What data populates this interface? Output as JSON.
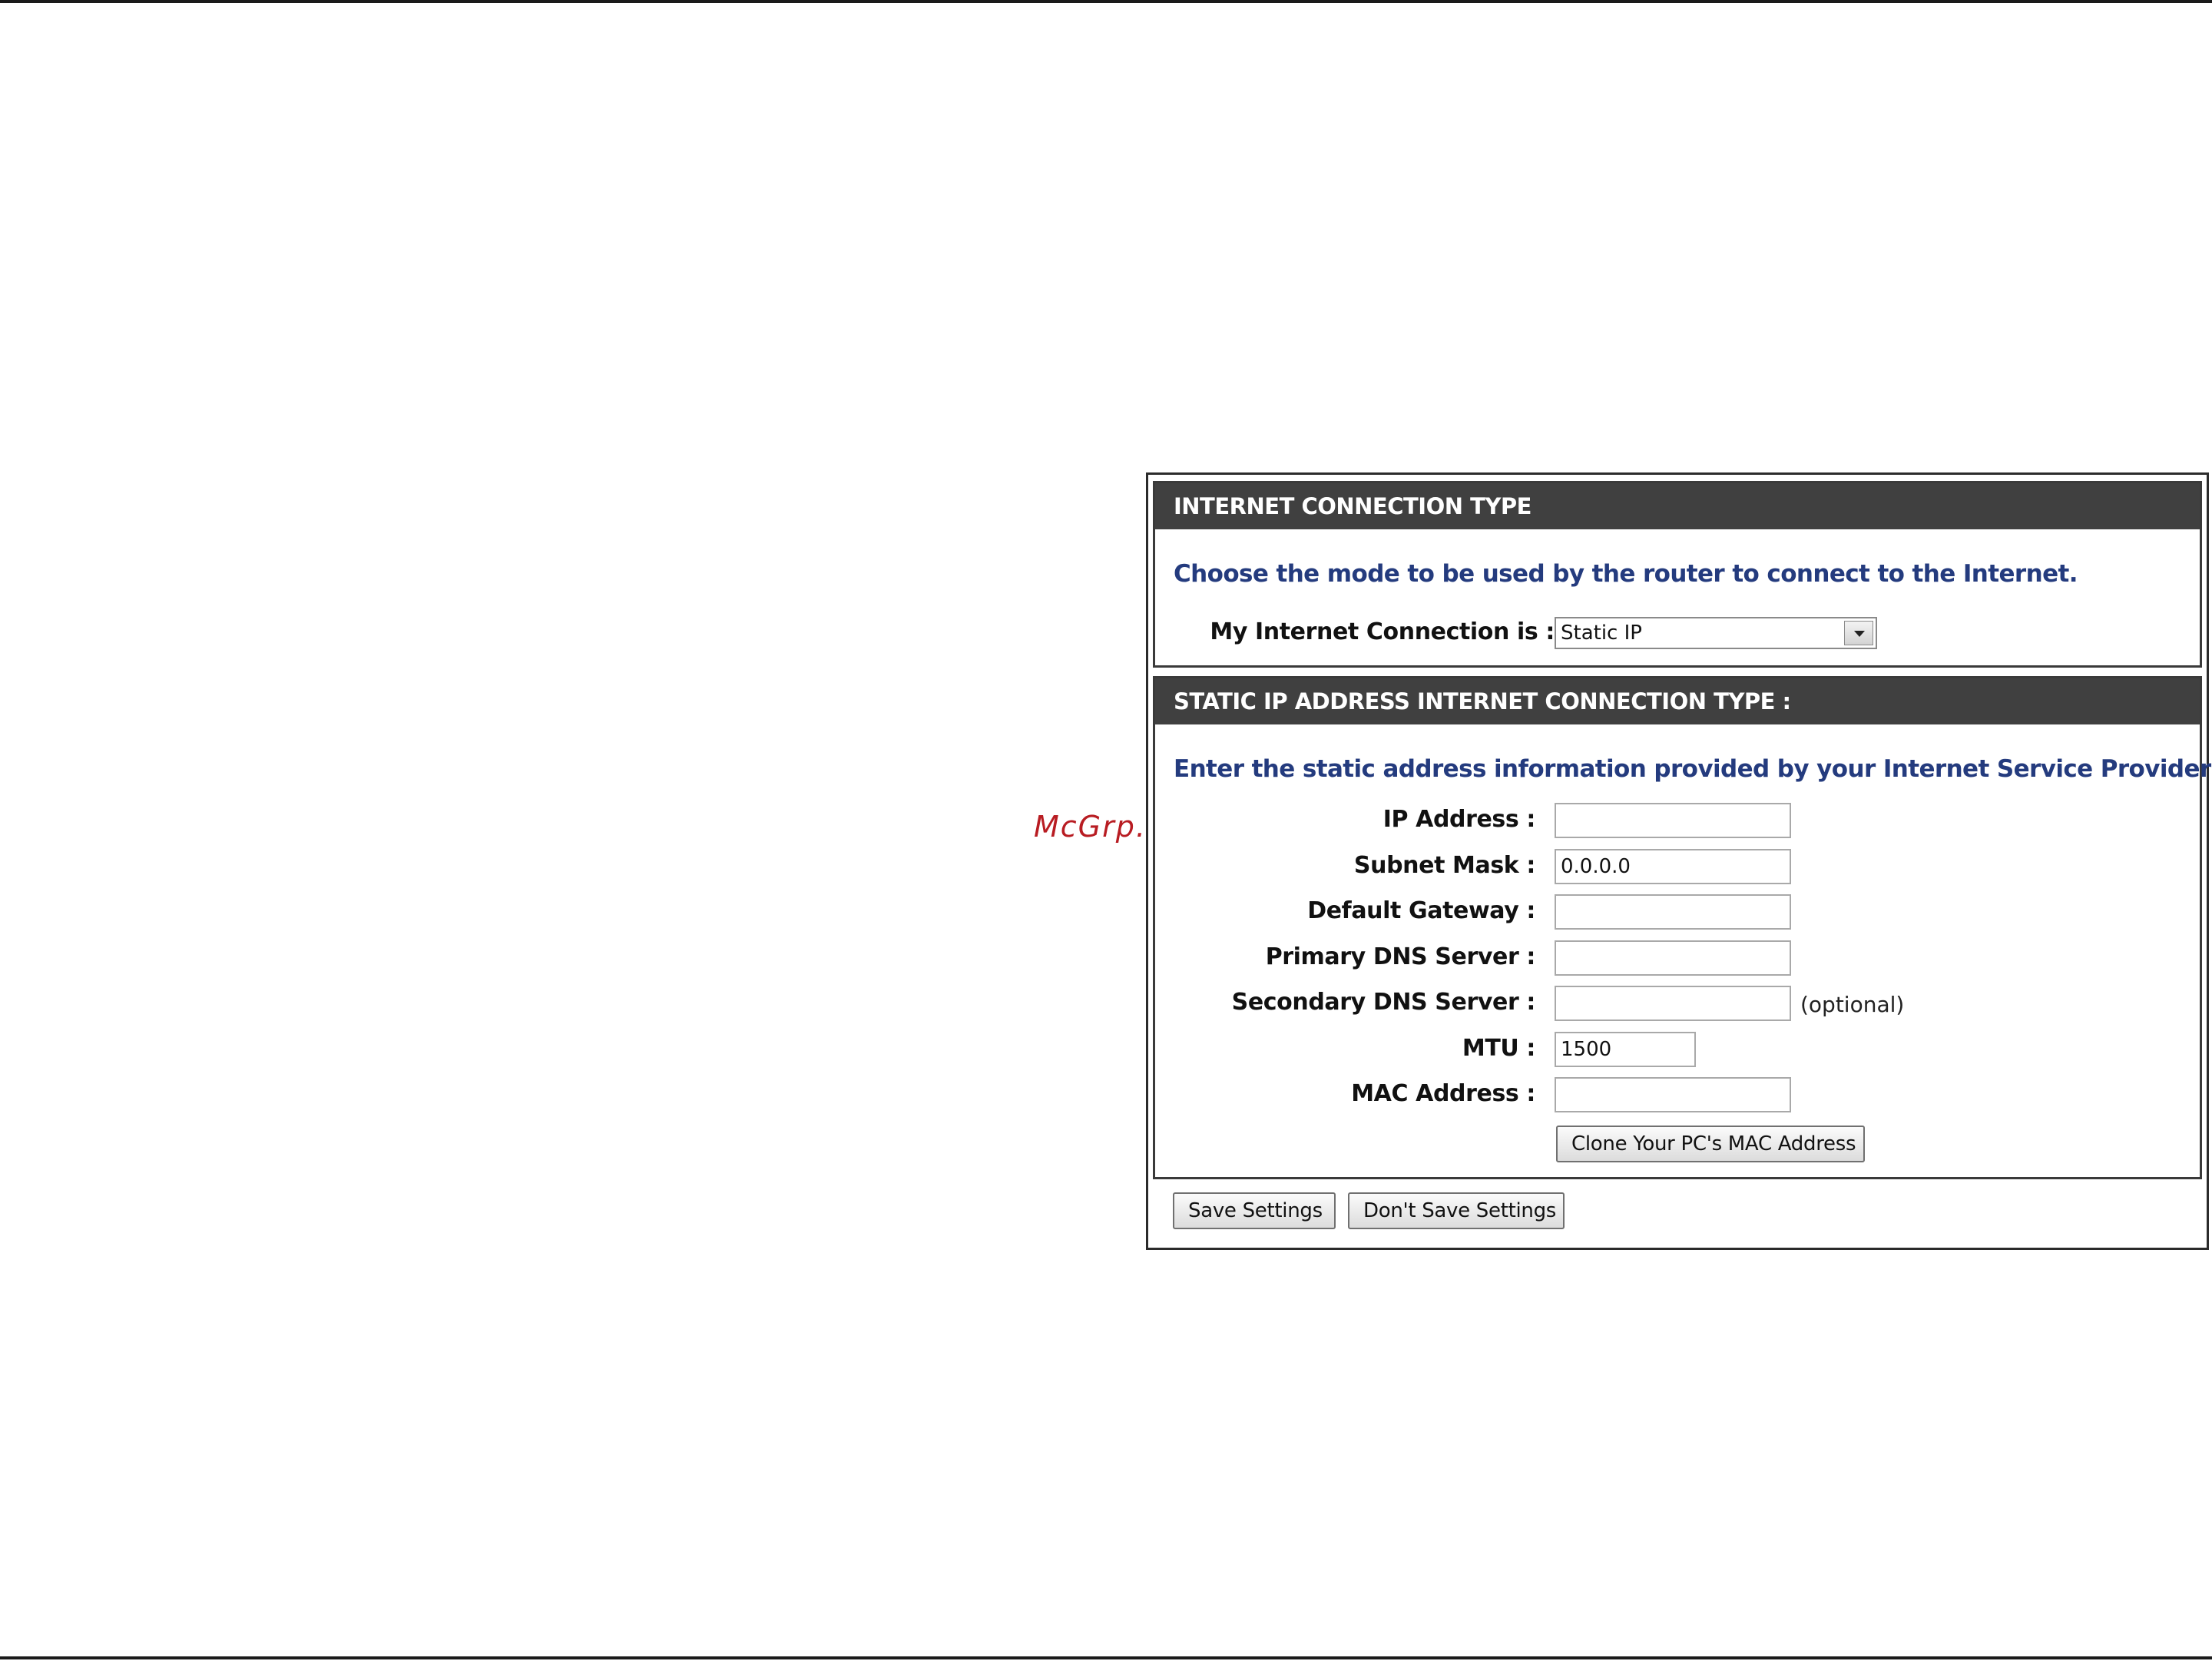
{
  "watermark": "McGrp.Ru",
  "connection_type": {
    "header": "INTERNET CONNECTION TYPE",
    "instruction": "Choose the mode to be used by the router to connect to the Internet.",
    "label": "My Internet Connection is :",
    "selected": "Static IP"
  },
  "static_ip": {
    "header": "STATIC IP ADDRESS INTERNET CONNECTION TYPE :",
    "instruction": "Enter the static address information provided by your Internet Service Provider (ISP).",
    "fields": {
      "ip_address": {
        "label": "IP Address :",
        "value": ""
      },
      "subnet_mask": {
        "label": "Subnet Mask :",
        "value": "0.0.0.0"
      },
      "default_gateway": {
        "label": "Default Gateway :",
        "value": ""
      },
      "primary_dns": {
        "label": "Primary DNS Server :",
        "value": ""
      },
      "secondary_dns": {
        "label": "Secondary DNS Server :",
        "value": "",
        "note": "(optional)"
      },
      "mtu": {
        "label": "MTU :",
        "value": "1500"
      },
      "mac_address": {
        "label": "MAC Address :",
        "value": ""
      }
    },
    "clone_button": "Clone Your PC's MAC Address"
  },
  "actions": {
    "save": "Save Settings",
    "dont_save": "Don't Save Settings"
  }
}
